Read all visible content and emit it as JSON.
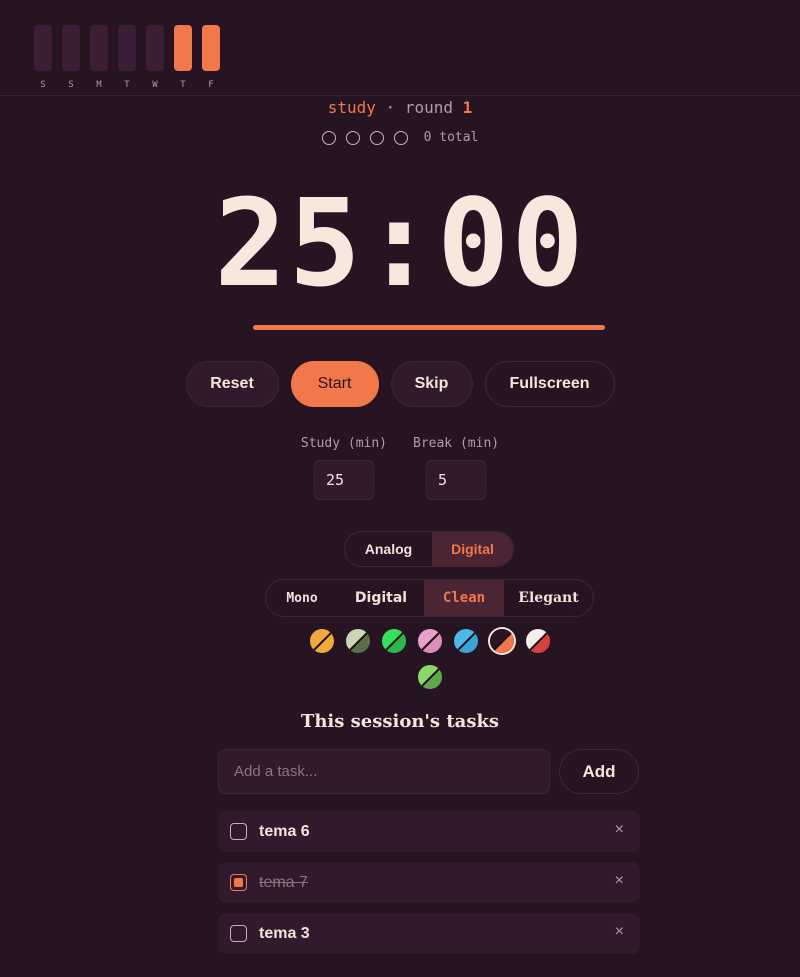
{
  "week": {
    "days": [
      {
        "label": "S",
        "active": false
      },
      {
        "label": "S",
        "active": false
      },
      {
        "label": "M",
        "active": false
      },
      {
        "label": "T",
        "active": false
      },
      {
        "label": "W",
        "active": false
      },
      {
        "label": "T",
        "active": true
      },
      {
        "label": "F",
        "active": true
      }
    ]
  },
  "session": {
    "mode": "study",
    "separator": "·",
    "round_label": "round",
    "round_number": "1",
    "total_label": "0 total",
    "dots_count": 4
  },
  "timer": {
    "display": "25:00",
    "progress": 1.0
  },
  "controls": {
    "reset": "Reset",
    "start": "Start",
    "skip": "Skip",
    "fullscreen": "Fullscreen"
  },
  "durations": {
    "study_label": "Study (min)",
    "study_value": "25",
    "break_label": "Break (min)",
    "break_value": "5"
  },
  "clock_style": {
    "options": [
      "Analog",
      "Digital"
    ],
    "selected": "Digital"
  },
  "font_style": {
    "options": [
      "Mono",
      "Digital",
      "Clean",
      "Elegant"
    ],
    "selected": "Clean"
  },
  "themes": [
    {
      "name": "amber-icon",
      "a": "#f2a93b",
      "b": "#f2a93b"
    },
    {
      "name": "sage-icon",
      "a": "#c9d6b7",
      "b": "#5b6e45"
    },
    {
      "name": "green-icon",
      "a": "#38e05a",
      "b": "#2ab848"
    },
    {
      "name": "pink-icon",
      "a": "#e9a0c9",
      "b": "#d98fb9"
    },
    {
      "name": "sky-icon",
      "a": "#4cb8e8",
      "b": "#3aa4d4"
    },
    {
      "name": "ember-icon",
      "a": "#2a1524",
      "b": "#f0784a",
      "selected": true
    },
    {
      "name": "red-icon",
      "a": "#f5eee8",
      "b": "#d8413a"
    },
    {
      "name": "lime-icon",
      "a": "#8bd76a",
      "b": "#5fa84a"
    }
  ],
  "tasks": {
    "title": "This session's tasks",
    "placeholder": "Add a task...",
    "add_label": "Add",
    "remove_glyph": "×",
    "items": [
      {
        "text": "tema 6",
        "done": false
      },
      {
        "text": "tema 7",
        "done": true
      },
      {
        "text": "tema 3",
        "done": false
      }
    ]
  }
}
